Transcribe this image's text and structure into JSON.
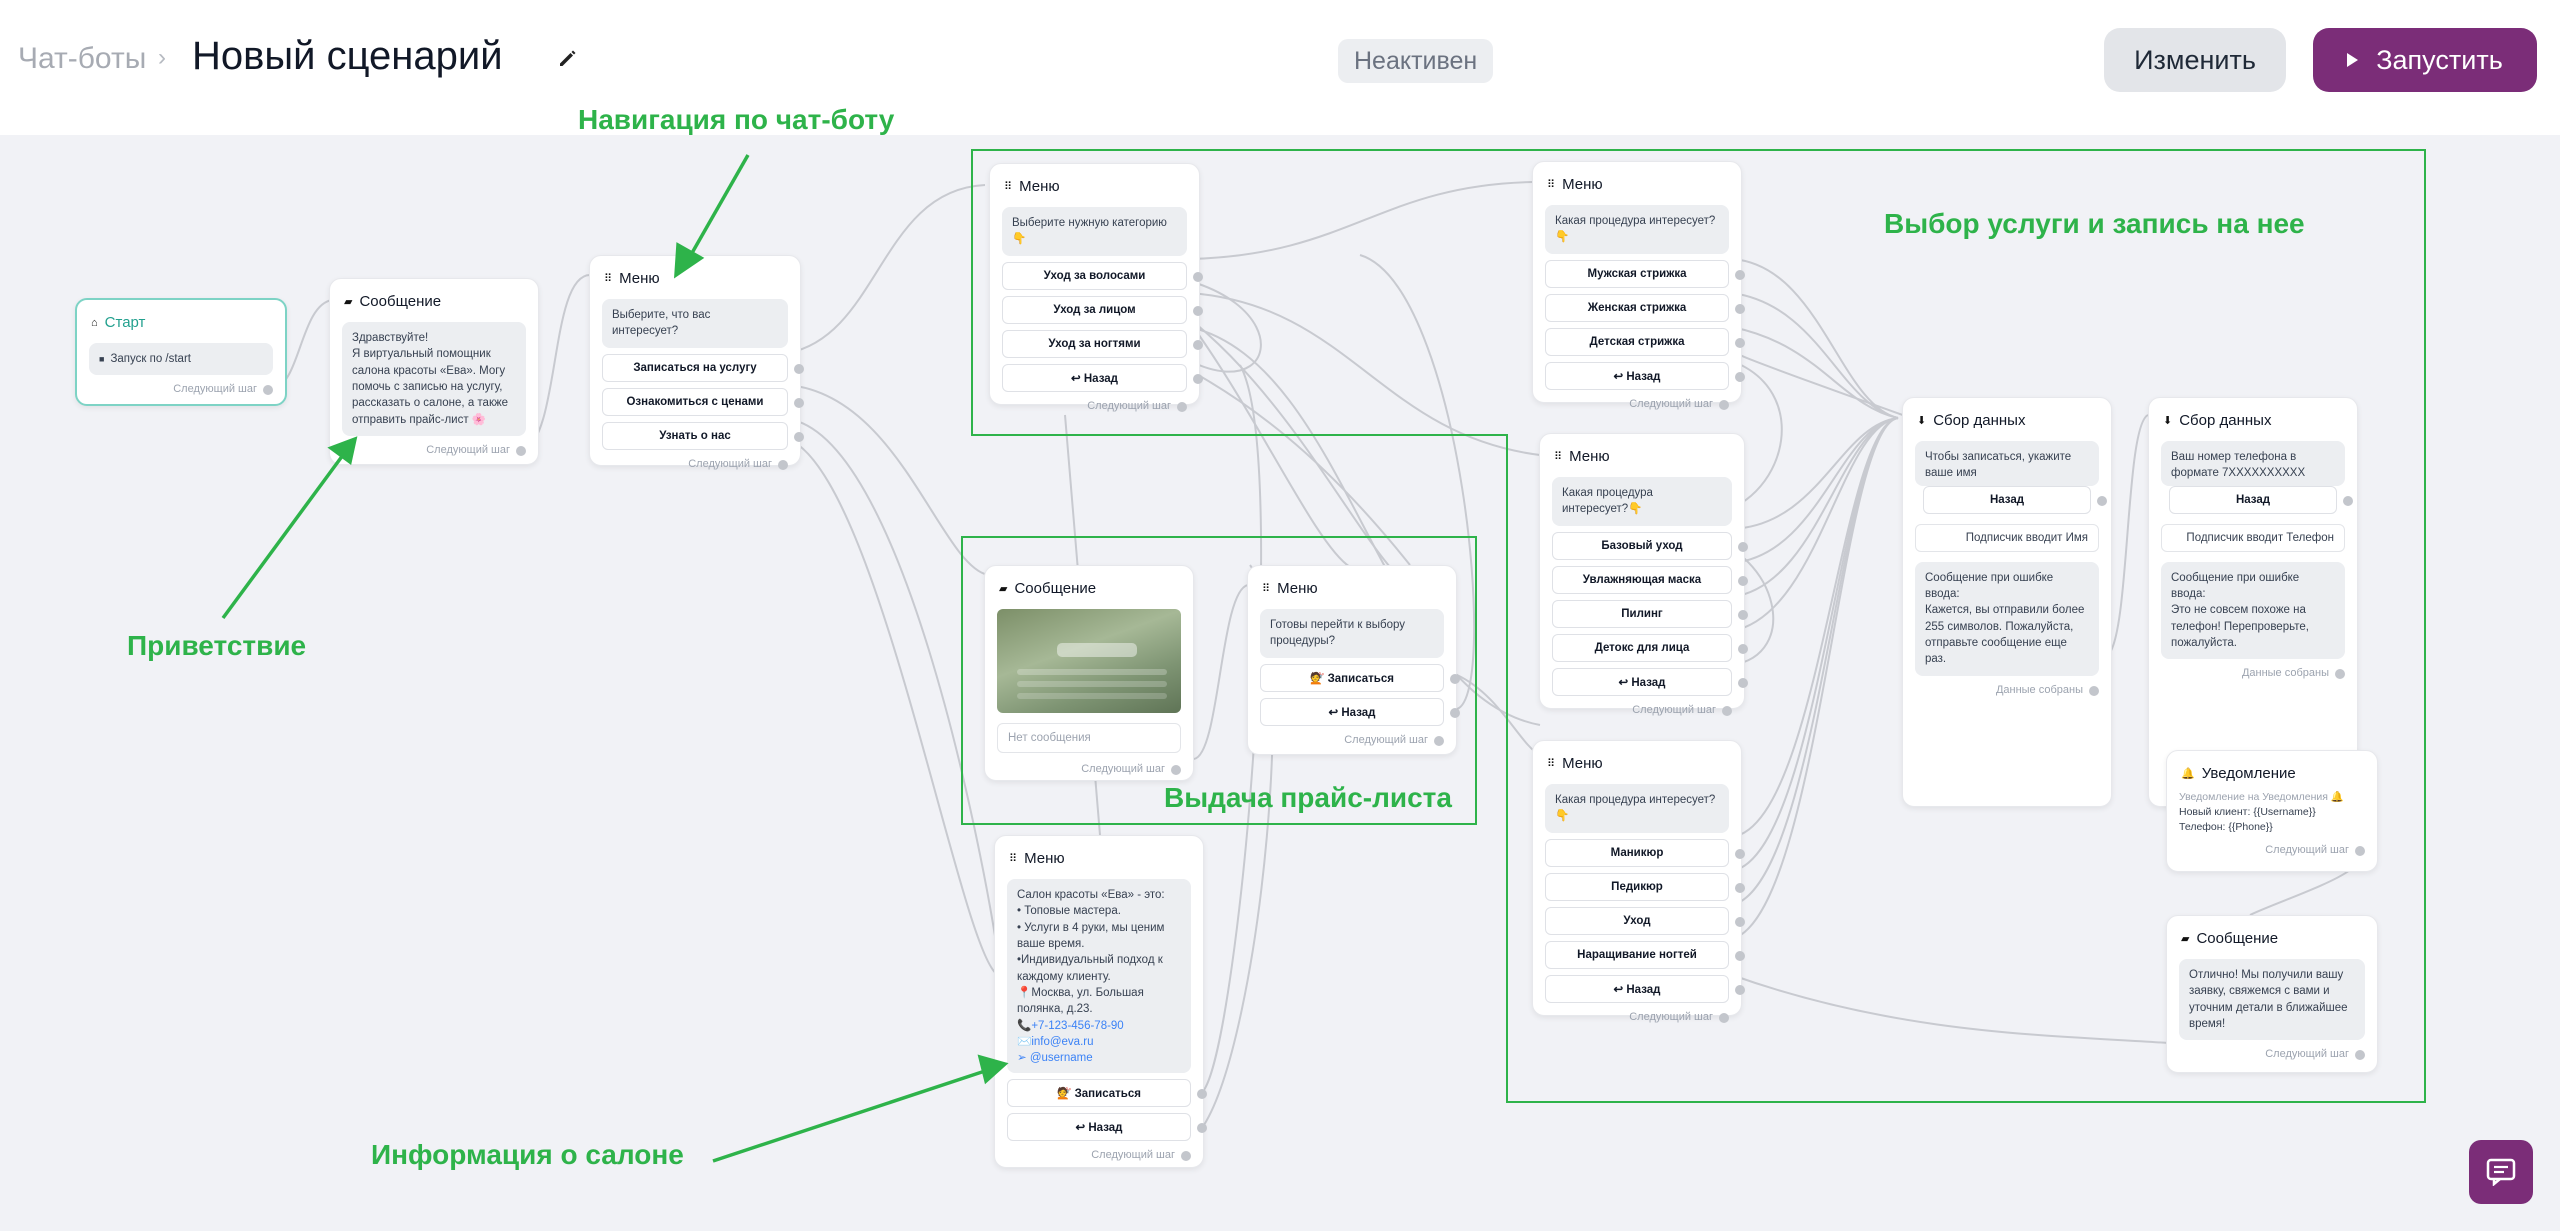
{
  "header": {
    "breadcrumb": "Чат-боты",
    "title": "Новый сценарий",
    "status": "Неактивен",
    "edit_button": "Изменить",
    "run_button": "Запустить"
  },
  "nodes": {
    "start": {
      "title": "Старт",
      "trigger": "Запуск по /start",
      "next": "Следующий шаг"
    },
    "greeting": {
      "title": "Сообщение",
      "text": "Здравствуйте!\nЯ виртуальный помощник салона красоты «Ева». Могу помочь с записью на услугу, рассказать о салоне, а также отправить прайс-лист 🌸",
      "next": "Следующий шаг"
    },
    "main_menu": {
      "title": "Меню",
      "question": "Выберите, что вас интересует?",
      "options": [
        "Записаться на услугу",
        "Ознакомиться с ценами",
        "Узнать о нас"
      ],
      "next": "Следующий шаг"
    },
    "category_menu": {
      "title": "Меню",
      "question": "Выберите нужную категорию 👇",
      "options": [
        "Уход за волосами",
        "Уход за лицом",
        "Уход за ногтями",
        "↩ Назад"
      ],
      "next": "Следующий шаг"
    },
    "price_message": {
      "title": "Сообщение",
      "empty": "Нет сообщения",
      "next": "Следующий шаг"
    },
    "price_menu": {
      "title": "Меню",
      "question": "Готовы перейти к выбору процедуры?",
      "options": [
        "💇 Записаться",
        "↩ Назад"
      ],
      "next": "Следующий шаг"
    },
    "about_menu": {
      "title": "Меню",
      "text": "Салон красоты «Ева» - это:\n• Топовые мастера.\n• Услуги в 4 руки, мы ценим ваше время.\n•Индивидуальный подход к каждому клиенту.\n📍Москва, ул. Большая полянка, д.23.",
      "phone": "📞+7-123-456-78-90",
      "email": "✉️info@eva.ru",
      "tg": "➢ @username",
      "options": [
        "💇 Записаться",
        "↩ Назад"
      ],
      "next": "Следующий шаг"
    },
    "hair_menu": {
      "title": "Меню",
      "question": "Какая процедура интересует?👇",
      "options": [
        "Мужская стрижка",
        "Женская стрижка",
        "Детская стрижка",
        "↩ Назад"
      ],
      "next": "Следующий шаг"
    },
    "face_menu": {
      "title": "Меню",
      "question": "Какая процедура интересует?👇",
      "options": [
        "Базовый уход",
        "Увлажняющая маска",
        "Пилинг",
        "Детокс для лица",
        "↩ Назад"
      ],
      "next": "Следующий шаг"
    },
    "nails_menu": {
      "title": "Меню",
      "question": "Какая процедура интересует?👇",
      "options": [
        "Маникюр",
        "Педикюр",
        "Уход",
        "Наращивание ногтей",
        "↩ Назад"
      ],
      "next": "Следующий шаг"
    },
    "collect_name": {
      "title": "Сбор данных",
      "question": "Чтобы записаться, укажите ваше имя",
      "back": "Назад",
      "input": "Подписчик вводит Имя",
      "error": "Сообщение при ошибке ввода:\nКажется, вы отправили более 255 символов. Пожалуйста, отправьте сообщение еще раз.",
      "done": "Данные собраны"
    },
    "collect_phone": {
      "title": "Сбор данных",
      "question": "Ваш номер телефона в формате 7XXXXXXXXXX",
      "back": "Назад",
      "input": "Подписчик вводит Телефон",
      "error": "Сообщение при ошибке ввода:\nЭто не совсем похоже на телефон! Перепроверьте, пожалуйста.",
      "done": "Данные собраны"
    },
    "notification": {
      "title": "Уведомление",
      "line1": "Уведомление на Уведомления 🔔",
      "line2": "Новый клиент: {{Username}}",
      "line3": "Телефон: {{Phone}}",
      "next": "Следующий шаг"
    },
    "final_message": {
      "title": "Сообщение",
      "text": "Отлично! Мы получили вашу заявку, свяжемся с вами и уточним детали в ближайшее время!",
      "next": "Следующий шаг"
    }
  },
  "annotations": {
    "navigation": "Навигация по чат-боту",
    "greeting": "Приветствие",
    "service": "Выбор услуги и запись на нее",
    "price": "Выдача прайс-листа",
    "about": "Информация о салоне"
  },
  "colors": {
    "accent": "#7b2d78",
    "annotation": "#2eb34a",
    "canvas": "#f1f2f6"
  }
}
